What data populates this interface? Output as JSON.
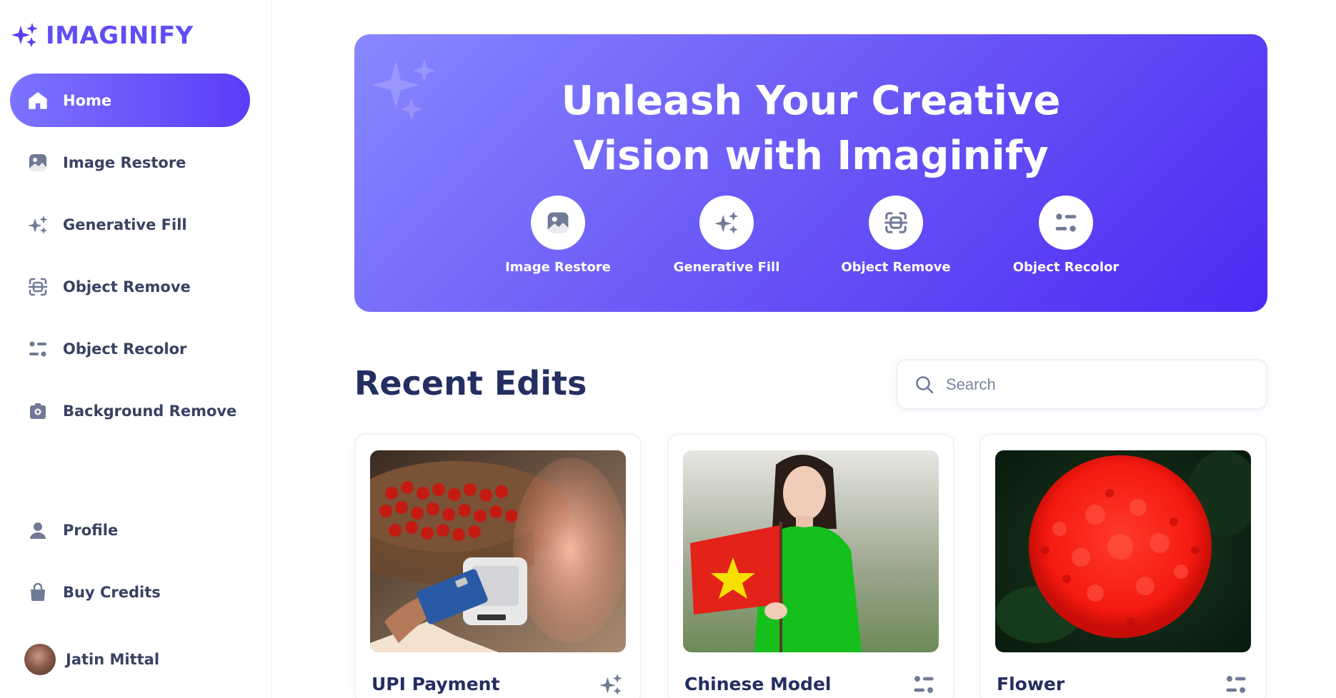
{
  "app": {
    "name": "IMAGINIFY",
    "logo_icon": "sparkle-logo-icon",
    "accent": "#624cf5"
  },
  "sidebar": {
    "items": [
      {
        "label": "Home",
        "icon": "home-icon",
        "active": true
      },
      {
        "label": "Image Restore",
        "icon": "image-icon"
      },
      {
        "label": "Generative Fill",
        "icon": "sparkles-icon"
      },
      {
        "label": "Object Remove",
        "icon": "scan-icon"
      },
      {
        "label": "Object Recolor",
        "icon": "filter-icon"
      },
      {
        "label": "Background Remove",
        "icon": "camera-icon"
      }
    ],
    "bottom_items": [
      {
        "label": "Profile",
        "icon": "user-icon"
      },
      {
        "label": "Buy Credits",
        "icon": "bag-icon"
      }
    ],
    "user": {
      "name": "Jatin Mittal"
    }
  },
  "hero": {
    "title_line1": "Unleash Your Creative",
    "title_line2": "Vision with Imaginify",
    "links": [
      {
        "label": "Image Restore",
        "icon": "image-icon"
      },
      {
        "label": "Generative Fill",
        "icon": "sparkles-icon"
      },
      {
        "label": "Object Remove",
        "icon": "scan-icon"
      },
      {
        "label": "Object Recolor",
        "icon": "filter-icon"
      }
    ]
  },
  "recent": {
    "title": "Recent Edits",
    "search_placeholder": "Search",
    "cards": [
      {
        "title": "UPI Payment",
        "icon": "sparkles-icon"
      },
      {
        "title": "Chinese Model",
        "icon": "filter-icon"
      },
      {
        "title": "Flower",
        "icon": "filter-icon"
      }
    ]
  }
}
